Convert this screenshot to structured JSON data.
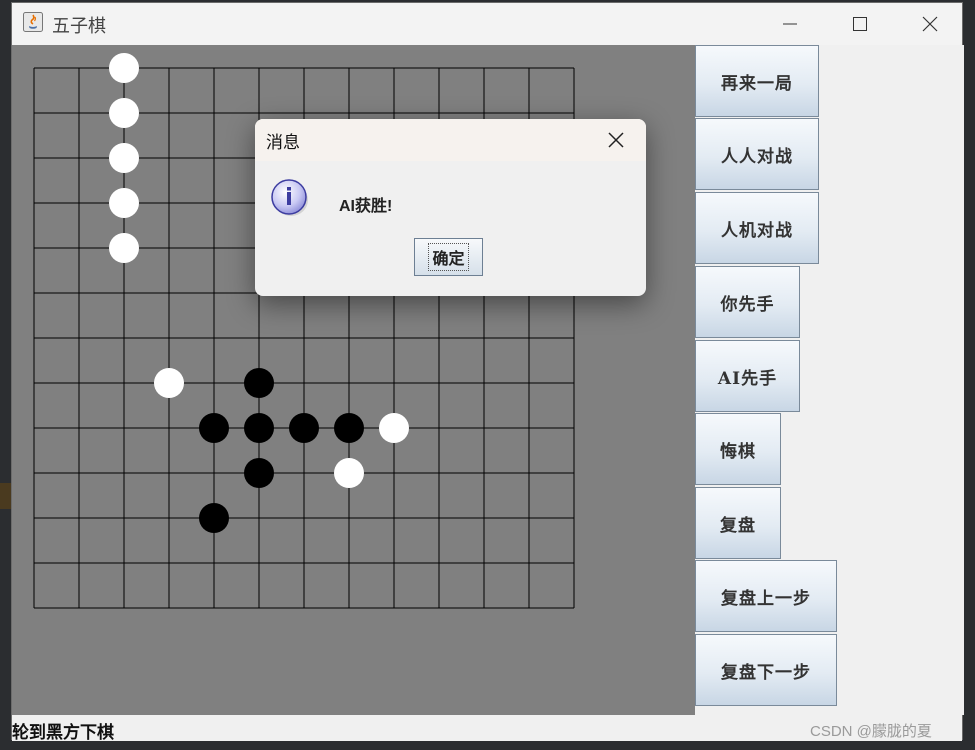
{
  "window": {
    "title": "五子棋"
  },
  "board": {
    "size": 13,
    "black_stones": [
      [
        5,
        7
      ],
      [
        4,
        8
      ],
      [
        5,
        8
      ],
      [
        7,
        8
      ],
      [
        5,
        9
      ],
      [
        4,
        10
      ],
      [
        6,
        8
      ]
    ],
    "white_stones": [
      [
        2,
        0
      ],
      [
        2,
        1
      ],
      [
        2,
        2
      ],
      [
        2,
        3
      ],
      [
        2,
        4
      ],
      [
        3,
        7
      ],
      [
        8,
        8
      ],
      [
        7,
        9
      ]
    ]
  },
  "sidebar": {
    "buttons": [
      {
        "label": "再来一局"
      },
      {
        "label": "人人对战"
      },
      {
        "label": "人机对战"
      },
      {
        "label": "你先手"
      },
      {
        "label": "AI先手"
      },
      {
        "label": "悔棋"
      },
      {
        "label": "复盘"
      },
      {
        "label": "复盘上一步"
      },
      {
        "label": "复盘下一步"
      }
    ]
  },
  "status": {
    "text": "轮到黑方下棋"
  },
  "dialog": {
    "title": "消息",
    "message": "AI获胜!",
    "ok_label": "确定"
  },
  "watermark": "CSDN @朦胧的夏",
  "colors": {
    "board": "#808080",
    "black_stone": "#000000",
    "white_stone": "#ffffff",
    "grid": "#000000"
  },
  "icons": [
    "java-app-icon",
    "minimize-icon",
    "maximize-icon",
    "close-icon",
    "info-icon",
    "dialog-close-icon"
  ]
}
